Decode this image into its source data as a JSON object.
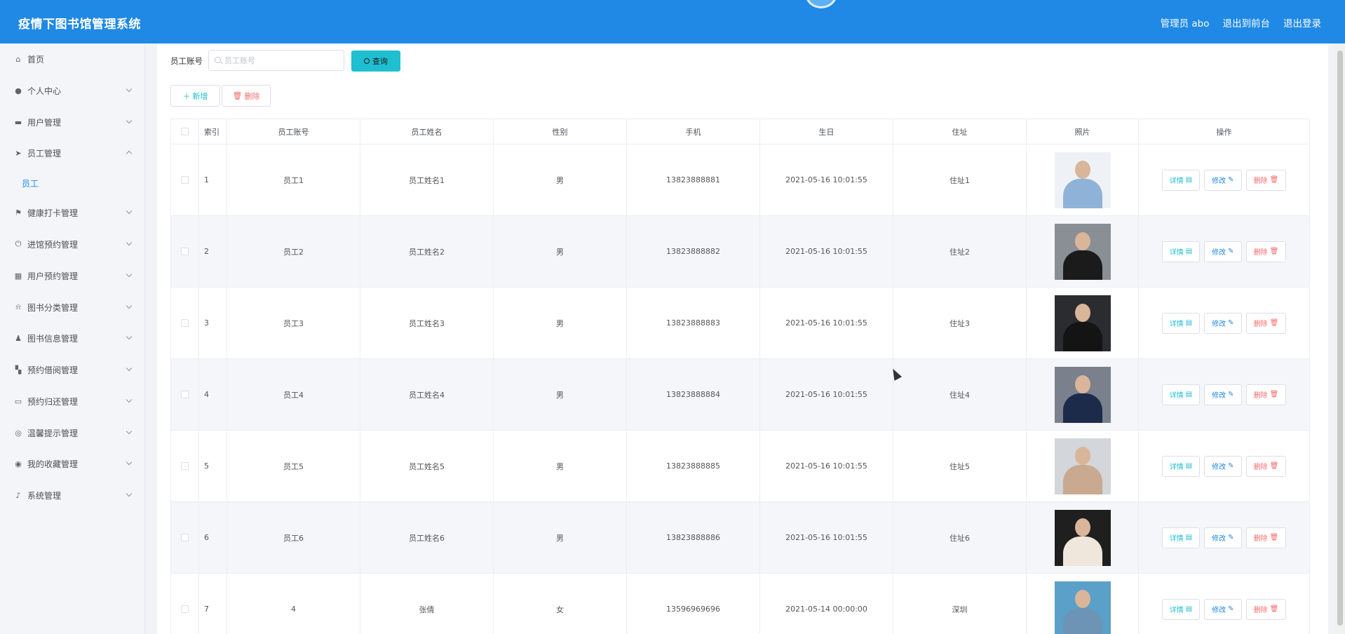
{
  "header": {
    "title": "疫情下图书馆管理系统",
    "user": "管理员 abo",
    "to_front": "退出到前台",
    "logout": "退出登录"
  },
  "sidebar": {
    "items": [
      {
        "label": "首页",
        "icon": "home-icon"
      },
      {
        "label": "个人中心",
        "icon": "user-icon"
      },
      {
        "label": "用户管理",
        "icon": "ticket-icon"
      },
      {
        "label": "员工管理",
        "icon": "send-icon"
      },
      {
        "label": "员工",
        "icon": ""
      },
      {
        "label": "健康打卡管理",
        "icon": "flag-icon"
      },
      {
        "label": "进馆预约管理",
        "icon": "power-icon"
      },
      {
        "label": "用户预约管理",
        "icon": "grid-icon"
      },
      {
        "label": "图书分类管理",
        "icon": "bell-off-icon"
      },
      {
        "label": "图书信息管理",
        "icon": "stamp-icon"
      },
      {
        "label": "预约借阅管理",
        "icon": "menu-icon"
      },
      {
        "label": "预约归还管理",
        "icon": "message-icon"
      },
      {
        "label": "温馨提示管理",
        "icon": "help-icon"
      },
      {
        "label": "我的收藏管理",
        "icon": "compass-icon"
      },
      {
        "label": "系统管理",
        "icon": "mic-icon"
      }
    ]
  },
  "search": {
    "label": "员工账号",
    "placeholder": "员工账号",
    "query_label": "查询"
  },
  "actions": {
    "add_label": "新增",
    "delete_label": "删除"
  },
  "table": {
    "columns": [
      "索引",
      "员工账号",
      "员工姓名",
      "性别",
      "手机",
      "生日",
      "住址",
      "照片",
      "操作"
    ],
    "rows": [
      {
        "index": "1",
        "account": "员工1",
        "name": "员工姓名1",
        "gender": "男",
        "phone": "13823888881",
        "birthday": "2021-05-16 10:01:55",
        "address": "住址1"
      },
      {
        "index": "2",
        "account": "员工2",
        "name": "员工姓名2",
        "gender": "男",
        "phone": "13823888882",
        "birthday": "2021-05-16 10:01:55",
        "address": "住址2"
      },
      {
        "index": "3",
        "account": "员工3",
        "name": "员工姓名3",
        "gender": "男",
        "phone": "13823888883",
        "birthday": "2021-05-16 10:01:55",
        "address": "住址3"
      },
      {
        "index": "4",
        "account": "员工4",
        "name": "员工姓名4",
        "gender": "男",
        "phone": "13823888884",
        "birthday": "2021-05-16 10:01:55",
        "address": "住址4"
      },
      {
        "index": "5",
        "account": "员工5",
        "name": "员工姓名5",
        "gender": "男",
        "phone": "13823888885",
        "birthday": "2021-05-16 10:01:55",
        "address": "住址5"
      },
      {
        "index": "6",
        "account": "员工6",
        "name": "员工姓名6",
        "gender": "男",
        "phone": "13823888886",
        "birthday": "2021-05-16 10:01:55",
        "address": "住址6"
      },
      {
        "index": "7",
        "account": "4",
        "name": "张倩",
        "gender": "女",
        "phone": "13596969696",
        "birthday": "2021-05-14 00:00:00",
        "address": "深圳"
      }
    ],
    "op_detail": "详情",
    "op_edit": "修改",
    "op_delete": "删除"
  },
  "colors": {
    "header_bg": "#1f89e5",
    "accent": "#1ebfd0",
    "danger": "#f56c6c",
    "active_menu": "#1f89e5"
  }
}
